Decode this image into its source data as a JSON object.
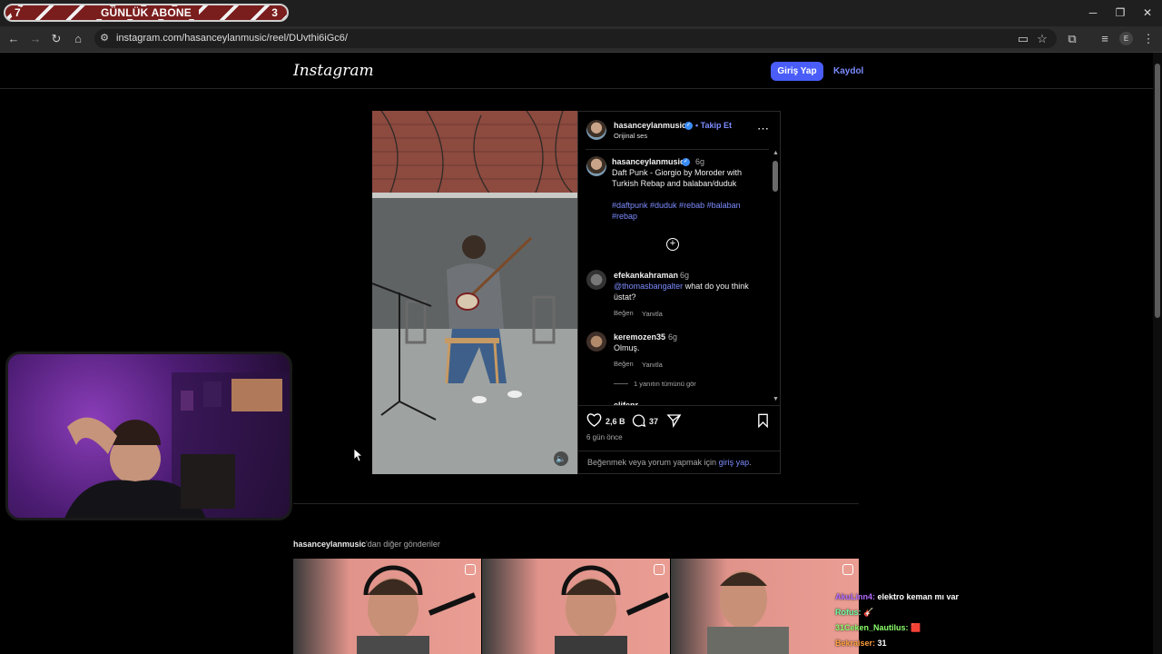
{
  "browser": {
    "banner": {
      "left_num": "7",
      "title": "GÜNLÜK ABONE",
      "right_num": "3"
    },
    "url": "instagram.com/hasanceylanmusic/reel/DUvthi6iGc6/",
    "profile_initial": "E"
  },
  "header": {
    "logo": "Instagram",
    "login": "Giriş Yap",
    "signup": "Kaydol"
  },
  "post": {
    "username": "hasanceylanmusic",
    "follow": "• Takip Et",
    "audio": "Orijinal ses",
    "caption_user": "hasanceylanmusic",
    "caption_time": "6g",
    "caption_text": "Daft Punk - Giorgio by Moroder with Turkish Rebap and balaban/duduk",
    "hashtags_line1": "#daftpunk #duduk #rebab #balaban",
    "hashtags_line2": "#rebap",
    "comments": [
      {
        "user": "efekankahraman",
        "time": "6g",
        "mention": "@thomasbangalter",
        "text": " what do you think",
        "text2": "üstat?",
        "like": "Beğen",
        "reply": "Yanıtla"
      },
      {
        "user": "keremozen35",
        "time": "6g",
        "text": "Olmuş.",
        "like": "Beğen",
        "reply": "Yanıtla"
      }
    ],
    "view_replies": "1 yanıtın tümünü gör",
    "partial_user": "elifenr",
    "likes": "2,6 B",
    "comment_count": "37",
    "date": "6 gün önce",
    "login_prompt_pre": "Beğenmek veya yorum yapmak için ",
    "login_prompt_link": "giriş yap",
    "login_prompt_post": "."
  },
  "more": {
    "user": "hasanceylanmusic",
    "suffix": "'dan diğer gönderiler"
  },
  "chat": [
    {
      "user": "AkuLinn4:",
      "msg": " elektro keman mı var",
      "color": "#b36bff"
    },
    {
      "user": "Rofus:",
      "msg": " 🎸",
      "color": "#6bff9d"
    },
    {
      "user": "31Ceken_Nautilus:",
      "msg": " 🟥",
      "color": "#8cff6b"
    },
    {
      "user": "Bekraiser:",
      "msg": " 31",
      "color": "#ff9f3d"
    }
  ]
}
